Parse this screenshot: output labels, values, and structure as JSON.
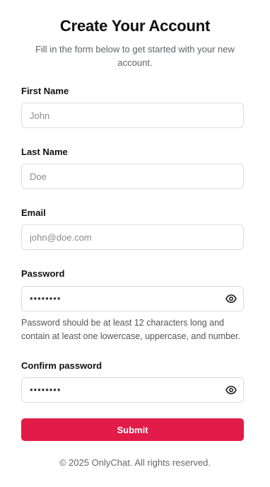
{
  "header": {
    "title": "Create Your Account",
    "subtitle": "Fill in the form below to get started with your new account."
  },
  "form": {
    "first_name": {
      "label": "First Name",
      "placeholder": "John"
    },
    "last_name": {
      "label": "Last Name",
      "placeholder": "Doe"
    },
    "email": {
      "label": "Email",
      "placeholder": "john@doe.com"
    },
    "password": {
      "label": "Password",
      "masked_value": "••••••••",
      "icon": "eye-icon",
      "hint": "Password should be at least 12 characters long and contain at least one lowercase, uppercase, and number."
    },
    "confirm_password": {
      "label": "Confirm password",
      "masked_value": "••••••••",
      "icon": "eye-icon"
    },
    "submit_label": "Submit"
  },
  "footer": {
    "text": "© 2025 OnlyChat. All rights reserved."
  },
  "colors": {
    "accent": "#e31b48",
    "input_border": "#dcdcdc",
    "muted_text": "#5f6368"
  }
}
